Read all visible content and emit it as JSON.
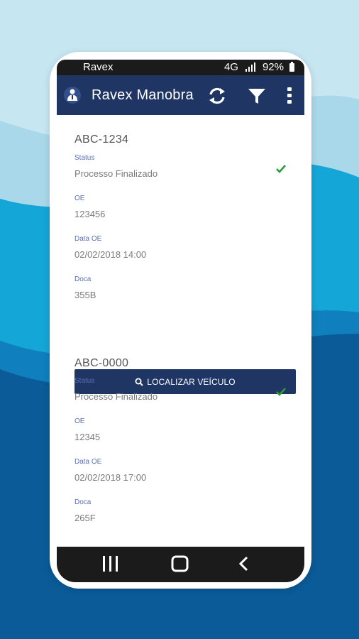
{
  "statusbar": {
    "carrier": "Ravex",
    "network": "4G",
    "battery": "92%"
  },
  "appbar": {
    "title": "Ravex Manobra",
    "actions": [
      "refresh-icon",
      "filter-icon",
      "more-vert-icon"
    ]
  },
  "vehicles": [
    {
      "plate": "ABC-1234",
      "status_label": "Status",
      "status": "Processo Finalizado",
      "oe_label": "OE",
      "oe": "123456",
      "data_label": "Data OE",
      "data": "02/02/2018 14:00",
      "doca_label": "Doca",
      "doca": "355B"
    },
    {
      "plate": "ABC-0000",
      "status_label": "Status",
      "status": "Processo Finalizado",
      "oe_label": "OE",
      "oe": "12345",
      "data_label": "Data OE",
      "data": "02/02/2018 17:00",
      "doca_label": "Doca",
      "doca": "265F"
    }
  ],
  "locate_button": {
    "label": "LOCALIZAR VEÍCULO",
    "icon": "search-icon"
  },
  "colors": {
    "primary": "#1f3564",
    "label": "#5b6fb8",
    "check": "#2e9b3a",
    "background": "#0a5b98"
  },
  "navbar": [
    "recents-icon",
    "home-icon",
    "back-icon"
  ]
}
